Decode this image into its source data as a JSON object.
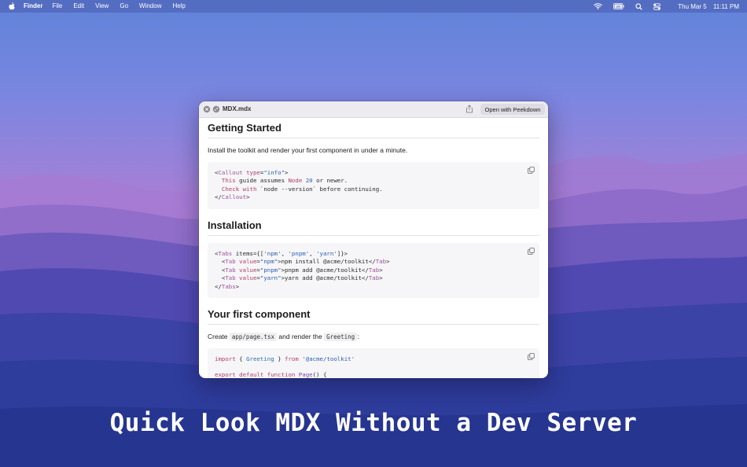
{
  "menubar": {
    "app_name": "Finder",
    "menus": [
      "File",
      "Edit",
      "View",
      "Go",
      "Window",
      "Help"
    ],
    "battery_label": "100",
    "date": "Thu Mar 5",
    "time": "11:11 PM"
  },
  "window": {
    "title": "MDX.mdx",
    "open_button": "Open with Peekdown"
  },
  "doc": {
    "section1": {
      "heading": "Getting Started",
      "paragraph": "Install the toolkit and render your first component in under a minute.",
      "code": {
        "l1": {
          "p1": "<",
          "tag": "Callout",
          "p2": " ",
          "attr": "type",
          "p3": "=",
          "str": "\"info\"",
          "p4": ">"
        },
        "l2": {
          "indent": "  ",
          "kw1": "This",
          "t1": " guide assumes ",
          "kw2": "Node",
          "t2": " ",
          "num": "20",
          "t3": " or newer."
        },
        "l3": {
          "indent": "  ",
          "kw1": "Check",
          "t1": " ",
          "kw2": "with",
          "t2": " `node --version` before continuing."
        },
        "l4": {
          "p1": "</",
          "tag": "Callout",
          "p2": ">"
        }
      }
    },
    "section2": {
      "heading": "Installation",
      "code": {
        "l1": {
          "p1": "<",
          "tag": "Tabs",
          "p2": " items={[",
          "s1": "'npm'",
          "c1": ", ",
          "s2": "'pnpm'",
          "c2": ", ",
          "s3": "'yarn'",
          "p3": "]}>"
        },
        "l2": {
          "indent": "  <",
          "tag": "Tab",
          "sp": " ",
          "attr": "value",
          "eq": "=",
          "str": "\"npm\"",
          "text": ">npm install @acme/toolkit</",
          "tag2": "Tab",
          "end": ">"
        },
        "l3": {
          "indent": "  <",
          "tag": "Tab",
          "sp": " ",
          "attr": "value",
          "eq": "=",
          "str": "\"pnpm\"",
          "text": ">pnpm add @acme/toolkit</",
          "tag2": "Tab",
          "end": ">"
        },
        "l4": {
          "indent": "  <",
          "tag": "Tab",
          "sp": " ",
          "attr": "value",
          "eq": "=",
          "str": "\"yarn\"",
          "text": ">yarn add @acme/toolkit</",
          "tag2": "Tab",
          "end": ">"
        },
        "l5": {
          "p1": "</",
          "tag": "Tabs",
          "p2": ">"
        }
      }
    },
    "section3": {
      "heading": "Your first component",
      "para_before": "Create ",
      "code1": "app/page.tsx",
      "para_mid": " and render the ",
      "code2": "Greeting",
      "para_after": ":",
      "code": {
        "l1": {
          "kw": "import",
          "t1": " { ",
          "comp": "Greeting",
          "t2": " } ",
          "kw2": "from",
          "t3": " ",
          "str": "'@acme/toolkit'"
        },
        "l2": {
          "kw": "export default function",
          "t1": " ",
          "fn": "Page",
          "t2": "() {"
        }
      }
    }
  },
  "headline": "Quick Look MDX Without a Dev Server"
}
